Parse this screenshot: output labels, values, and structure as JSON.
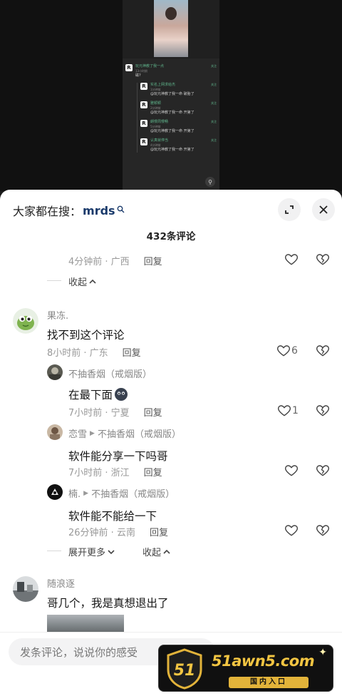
{
  "video": {
    "mini_comments": [
      {
        "name": "玩元神教了我一点",
        "time": "13小时前",
        "text": "磁?",
        "tag": "关注"
      },
      {
        "name": "实名上网求给杰",
        "time": "1分钟前",
        "text": "@玩元神教了我一命 破胎了",
        "tag": "关注"
      },
      {
        "name": "雅颖颖",
        "time": "2分钟前",
        "text": "@玩元神教了我一命 开第了",
        "tag": "关注"
      },
      {
        "name": "朗慢周慢畅",
        "time": "5分钟前",
        "text": "@玩元神教了我一命 开第了",
        "tag": "关注"
      },
      {
        "name": "认真就停当",
        "time": "4分钟前",
        "text": "@玩元神教了我一命 开第了",
        "tag": "关注"
      }
    ],
    "avatar_letter": "R"
  },
  "header": {
    "trend_prefix": "大家都在搜：",
    "trend_keyword": "mrds",
    "comment_count": "432条评论"
  },
  "partial_top": {
    "time": "4分钟前 · 广西",
    "reply": "回复"
  },
  "fold_top": {
    "label": "收起",
    "chevron": "^"
  },
  "comment1": {
    "name": "果冻.",
    "text": "找不到这个评论",
    "time": "8小时前 · 广东",
    "reply": "回复",
    "likes": "6",
    "replies": [
      {
        "name": "不抽香烟（戒烟版）",
        "target": "",
        "text": "在最下面",
        "time": "7小时前 · 宁夏",
        "reply": "回复",
        "likes": "1"
      },
      {
        "name": "恋雪",
        "target": "不抽香烟（戒烟版）",
        "text": "软件能分享一下吗哥",
        "time": "7小时前 · 浙江",
        "reply": "回复",
        "likes": ""
      },
      {
        "name": "楠.",
        "target": "不抽香烟（戒烟版）",
        "text": "软件能不能给一下",
        "time": "26分钟前 · 云南",
        "reply": "回复",
        "likes": ""
      }
    ],
    "expand_more": "展开更多",
    "collapse": "收起"
  },
  "comment2": {
    "name": "随浪逐",
    "text": "哥几个，我是真想退出了"
  },
  "input": {
    "placeholder": "发条评论，说说你的感受"
  },
  "watermark": {
    "badge_number": "51",
    "domain": "51awn5.com",
    "subtitle": "国内入口"
  },
  "colors": {
    "accent_green": "#5fb48b",
    "keyword_blue": "#1a3a6b",
    "watermark_gold": "#f2c542"
  }
}
